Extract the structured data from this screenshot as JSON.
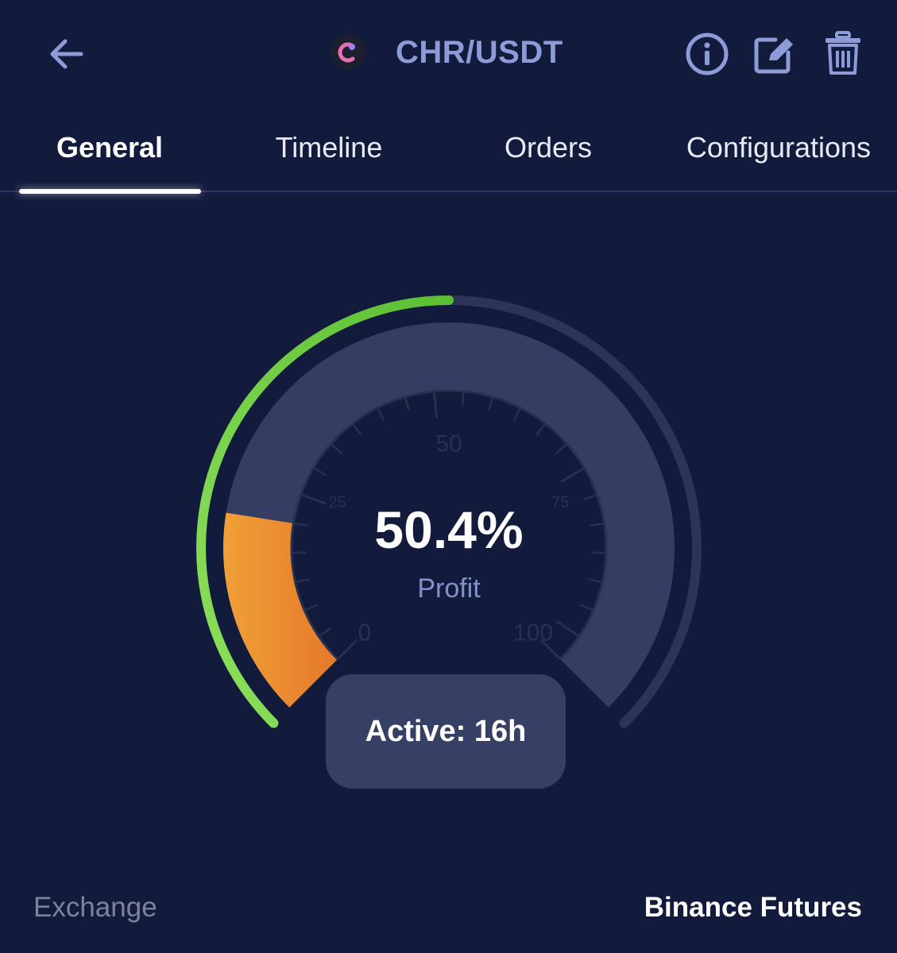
{
  "header": {
    "pair": "CHR/USDT",
    "coin_logo_letter": "c",
    "back_icon": "arrow-left-icon",
    "actions": [
      {
        "name": "info-icon"
      },
      {
        "name": "edit-icon"
      },
      {
        "name": "trash-icon"
      }
    ]
  },
  "tabs": [
    {
      "label": "General",
      "active": true
    },
    {
      "label": "Timeline",
      "active": false
    },
    {
      "label": "Orders",
      "active": false
    },
    {
      "label": "Configurations",
      "active": false
    }
  ],
  "gauge": {
    "value_text": "50.4%",
    "label": "Profit",
    "profit_percent": 50.4,
    "outer_progress_fraction": 0.5,
    "inner_fill_fraction": 0.2,
    "tick_labels": [
      "0",
      "25",
      "50",
      "75",
      "100"
    ]
  },
  "status": {
    "active_text": "Active: 16h"
  },
  "info": {
    "exchange_label": "Exchange",
    "exchange_value": "Binance Futures"
  },
  "colors": {
    "background": "#131b3d",
    "accent_green": "#6cc93c",
    "accent_orange": "#e8862e",
    "track": "#343e62",
    "muted_text": "#8391c9"
  }
}
